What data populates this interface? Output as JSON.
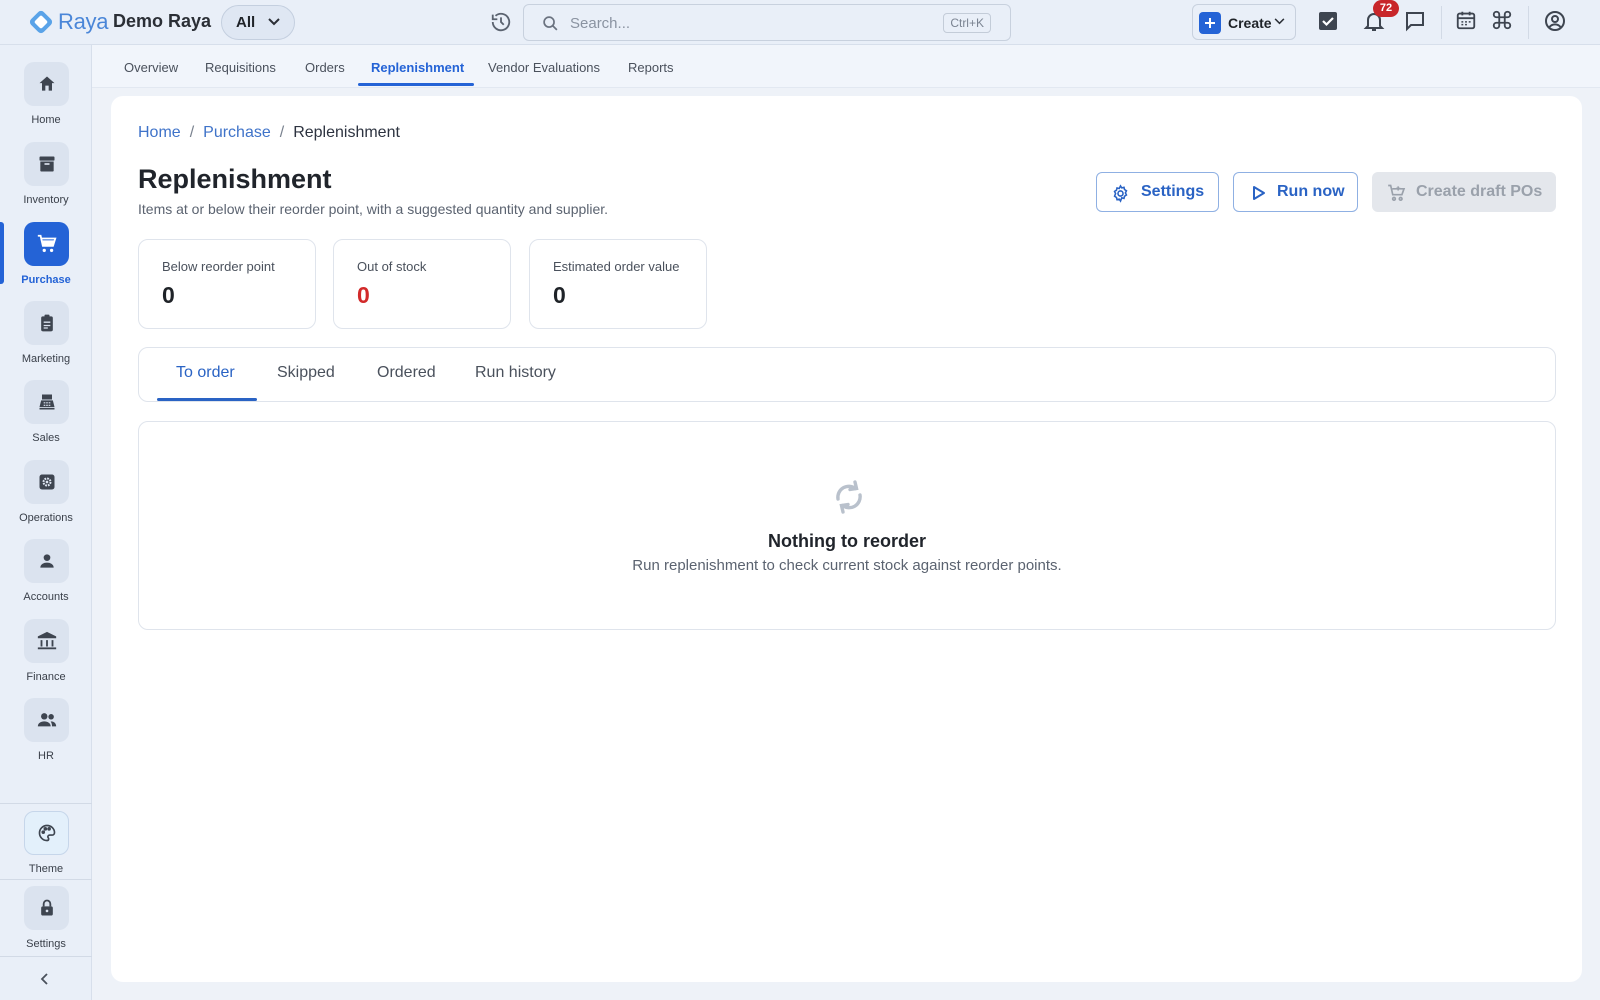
{
  "app": {
    "brand": "Raya",
    "company": "Demo Raya",
    "scope": "All",
    "search_placeholder": "Search...",
    "search_shortcut": "Ctrl+K",
    "create_label": "Create",
    "notification_count": "72"
  },
  "sidebar": {
    "items": [
      {
        "label": "Home",
        "icon": "home-icon"
      },
      {
        "label": "Inventory",
        "icon": "archive-icon"
      },
      {
        "label": "Purchase",
        "icon": "cart-icon"
      },
      {
        "label": "Marketing",
        "icon": "clipboard-icon"
      },
      {
        "label": "Sales",
        "icon": "register-icon"
      },
      {
        "label": "Operations",
        "icon": "cog-box-icon"
      },
      {
        "label": "Accounts",
        "icon": "person-icon"
      },
      {
        "label": "Finance",
        "icon": "bank-icon"
      },
      {
        "label": "HR",
        "icon": "people-icon"
      }
    ],
    "active": "Purchase",
    "theme_label": "Theme",
    "settings_label": "Settings"
  },
  "subtabs": [
    "Overview",
    "Requisitions",
    "Orders",
    "Replenishment",
    "Vendor Evaluations",
    "Reports"
  ],
  "active_subtab": "Replenishment",
  "breadcrumb": {
    "home": "Home",
    "section": "Purchase",
    "current": "Replenishment"
  },
  "page": {
    "title": "Replenishment",
    "subtitle": "Items at or below their reorder point, with a suggested quantity and supplier.",
    "settings_button": "Settings",
    "run_button": "Run now",
    "draft_button": "Create draft POs"
  },
  "stats": [
    {
      "label": "Below reorder point",
      "value": "0"
    },
    {
      "label": "Out of stock",
      "value": "0"
    },
    {
      "label": "Estimated order value",
      "value": "0"
    }
  ],
  "content_tabs": [
    "To order",
    "Skipped",
    "Ordered",
    "Run history"
  ],
  "active_content_tab": "To order",
  "empty_state": {
    "title": "Nothing to reorder",
    "message": "Run replenishment to check current stock against reorder points."
  },
  "colors": {
    "accent": "#2463d6",
    "danger": "#d22a2a",
    "badge": "#c8262a"
  }
}
